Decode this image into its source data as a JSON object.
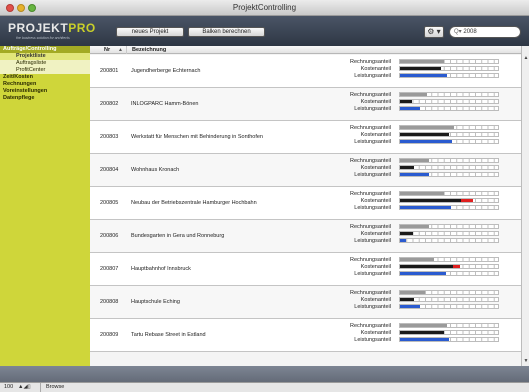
{
  "window": {
    "title": "ProjektControlling"
  },
  "header": {
    "logo_main": "PROJEKT",
    "logo_accent": "PRO",
    "slogan": "the business solution for architects",
    "new_project_label": "neues Projekt",
    "calc_bars_label": "Balken berechnen",
    "gear_menu_label": "⚙ ▾",
    "search_value": "2008",
    "search_glyph": "Q▾"
  },
  "sidebar": {
    "items": [
      {
        "label": "Aufträge/Controlling",
        "type": "group",
        "state": "active"
      },
      {
        "label": "Projektliste",
        "type": "sub",
        "state": "active"
      },
      {
        "label": "Auftragsliste",
        "type": "sub",
        "state": "sel"
      },
      {
        "label": "ProfitCenter",
        "type": "sub",
        "state": "sel"
      },
      {
        "label": "Zeit/Kosten",
        "type": "group",
        "state": ""
      },
      {
        "label": "Rechnungen",
        "type": "group",
        "state": ""
      },
      {
        "label": "Voreinstellungen",
        "type": "group",
        "state": ""
      },
      {
        "label": "Datenpflege",
        "type": "group",
        "state": ""
      }
    ]
  },
  "table": {
    "col_nr": "Nr",
    "col_sort_glyph": "▲",
    "col_bez": "Bezeichnung",
    "bar_labels": [
      "Rechnungsanteil",
      "Kostenanteil",
      "Leistungsanteil"
    ],
    "rows": [
      {
        "nr": "200801",
        "bez": "Jugendherberge Echternach",
        "rechnung": 0.45,
        "kosten": 0.42,
        "kosten_red": 0.0,
        "leistung": 0.48
      },
      {
        "nr": "200802",
        "bez": "INLOGPARC Hamm-Bönen",
        "rechnung": 0.28,
        "kosten": 0.12,
        "kosten_red": 0.0,
        "leistung": 0.2
      },
      {
        "nr": "200803",
        "bez": "Werkstatt für Menschen mit Behinderung in Sonthofen",
        "rechnung": 0.55,
        "kosten": 0.5,
        "kosten_red": 0.0,
        "leistung": 0.53
      },
      {
        "nr": "200804",
        "bez": "Wohnhaus Kronach",
        "rechnung": 0.3,
        "kosten": 0.14,
        "kosten_red": 0.0,
        "leistung": 0.3
      },
      {
        "nr": "200805",
        "bez": "Neubau der Betriebszentrale Hamburger Hochbahn",
        "rechnung": 0.45,
        "kosten": 0.62,
        "kosten_red": 0.12,
        "leistung": 0.52
      },
      {
        "nr": "200806",
        "bez": "Bundesgarten in Gera und Ronneburg",
        "rechnung": 0.3,
        "kosten": 0.13,
        "kosten_red": 0.0,
        "leistung": 0.06
      },
      {
        "nr": "200807",
        "bez": "Hauptbahnhof Innsbruck",
        "rechnung": 0.35,
        "kosten": 0.54,
        "kosten_red": 0.07,
        "leistung": 0.47
      },
      {
        "nr": "200808",
        "bez": "Hauptschule Eching",
        "rechnung": 0.25,
        "kosten": 0.14,
        "kosten_red": 0.0,
        "leistung": 0.2
      },
      {
        "nr": "200809",
        "bez": "Tartu Rebase Street in Estland",
        "rechnung": 0.48,
        "kosten": 0.45,
        "kosten_red": 0.0,
        "leistung": 0.5
      }
    ]
  },
  "colors": {
    "rechnung": "#9a9a9a",
    "kosten": "#1a1a1a",
    "kosten_over": "#e02020",
    "leistung": "#2a5bd0",
    "sidebar": "#cfd63a"
  },
  "status": {
    "zoom": "100",
    "mode": "Browse"
  }
}
